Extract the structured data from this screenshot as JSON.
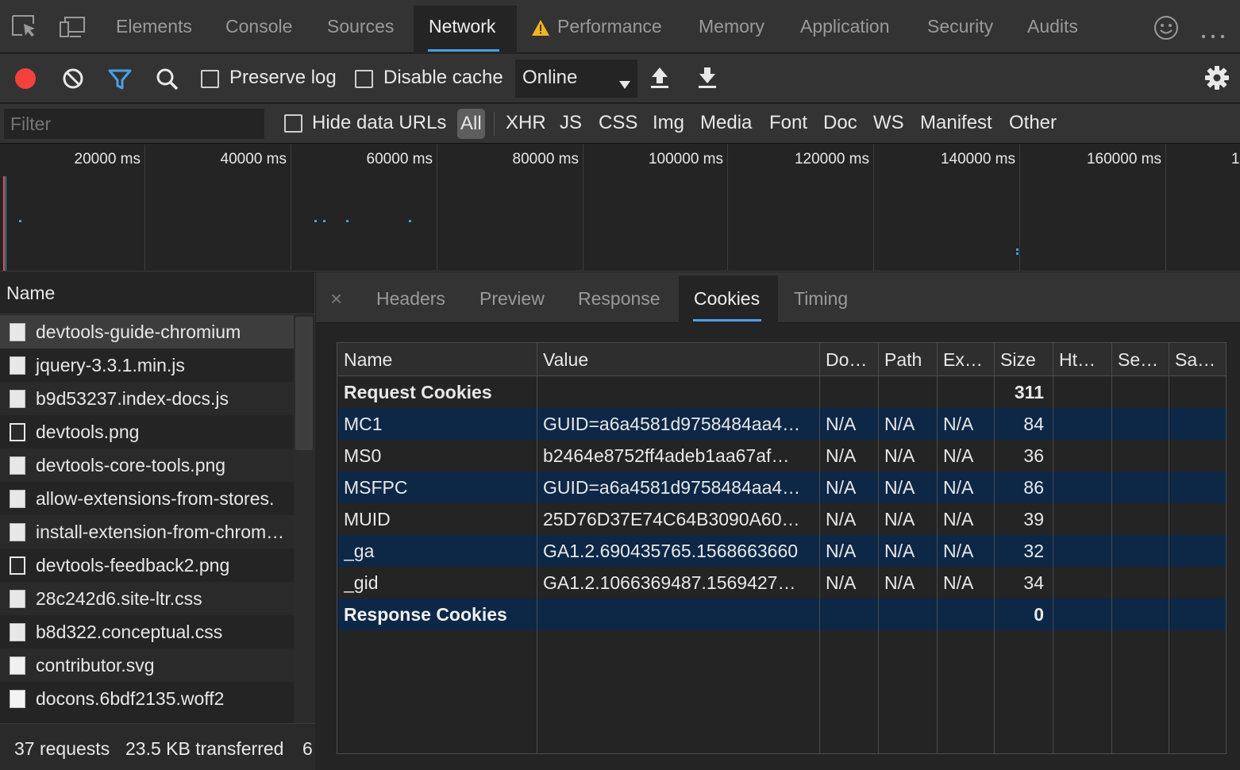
{
  "top_tabs": [
    {
      "label": "Elements"
    },
    {
      "label": "Console"
    },
    {
      "label": "Sources"
    },
    {
      "label": "Network"
    },
    {
      "label": "Performance"
    },
    {
      "label": "Memory"
    },
    {
      "label": "Application"
    },
    {
      "label": "Security"
    },
    {
      "label": "Audits"
    }
  ],
  "active_tab": "Network",
  "toolbar": {
    "preserve_log_label": "Preserve log",
    "disable_cache_label": "Disable cache",
    "throttling_value": "Online",
    "record_color": "#f5413b",
    "filter_active_color": "#4b9fe8"
  },
  "filter_bar": {
    "placeholder": "Filter",
    "hide_data_urls_label": "Hide data URLs",
    "types": [
      "All",
      "XHR",
      "JS",
      "CSS",
      "Img",
      "Media",
      "Font",
      "Doc",
      "WS",
      "Manifest",
      "Other"
    ]
  },
  "overview": {
    "ticks": [
      "20000 ms",
      "40000 ms",
      "60000 ms",
      "80000 ms",
      "100000 ms",
      "120000 ms",
      "140000 ms",
      "160000 ms",
      "1"
    ]
  },
  "request_list": {
    "header": "Name",
    "items": [
      {
        "name": "devtools-guide-chromium"
      },
      {
        "name": "jquery-3.3.1.min.js"
      },
      {
        "name": "b9d53237.index-docs.js"
      },
      {
        "name": "devtools.png"
      },
      {
        "name": "devtools-core-tools.png"
      },
      {
        "name": "allow-extensions-from-stores."
      },
      {
        "name": "install-extension-from-chrom…"
      },
      {
        "name": "devtools-feedback2.png"
      },
      {
        "name": "28c242d6.site-ltr.css"
      },
      {
        "name": "b8d322.conceptual.css"
      },
      {
        "name": "contributor.svg"
      },
      {
        "name": "docons.6bdf2135.woff2"
      }
    ],
    "status": {
      "requests": "37 requests",
      "transferred": "23.5 KB transferred",
      "extra": "6"
    }
  },
  "detail_tabs": [
    {
      "label": "Headers"
    },
    {
      "label": "Preview"
    },
    {
      "label": "Response"
    },
    {
      "label": "Cookies"
    },
    {
      "label": "Timing"
    }
  ],
  "active_detail_tab": "Cookies",
  "cookies_table": {
    "columns": [
      "Name",
      "Value",
      "Do…",
      "Path",
      "Ex…",
      "Size",
      "Ht…",
      "Se…",
      "Sa…"
    ],
    "request_section": {
      "label": "Request Cookies",
      "size": "311"
    },
    "rows": [
      {
        "name": "MC1",
        "value": "GUID=a6a4581d9758484aa4…",
        "domain": "N/A",
        "path": "N/A",
        "expires": "N/A",
        "size": "84"
      },
      {
        "name": "MS0",
        "value": "b2464e8752ff4adeb1aa67af…",
        "domain": "N/A",
        "path": "N/A",
        "expires": "N/A",
        "size": "36"
      },
      {
        "name": "MSFPC",
        "value": "GUID=a6a4581d9758484aa4…",
        "domain": "N/A",
        "path": "N/A",
        "expires": "N/A",
        "size": "86"
      },
      {
        "name": "MUID",
        "value": "25D76D37E74C64B3090A60…",
        "domain": "N/A",
        "path": "N/A",
        "expires": "N/A",
        "size": "39"
      },
      {
        "name": "_ga",
        "value": "GA1.2.690435765.1568663660",
        "domain": "N/A",
        "path": "N/A",
        "expires": "N/A",
        "size": "32"
      },
      {
        "name": "_gid",
        "value": "GA1.2.1066369487.1569427…",
        "domain": "N/A",
        "path": "N/A",
        "expires": "N/A",
        "size": "34"
      }
    ],
    "response_section": {
      "label": "Response Cookies",
      "size": "0"
    }
  }
}
